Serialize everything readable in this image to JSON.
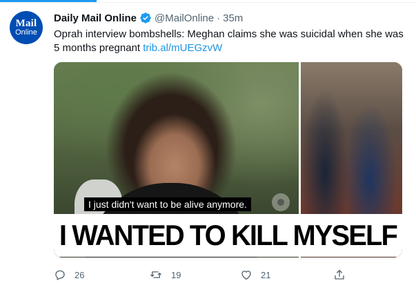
{
  "tweet": {
    "avatar": {
      "line1": "Mail",
      "line2": "Online"
    },
    "author_name": "Daily Mail Online",
    "handle": "@MailOnline",
    "separator": "·",
    "time": "35m",
    "text": "Oprah interview bombshells: Meghan claims she was suicidal when she was 5 months pregnant",
    "link": "trib.al/mUEGzvW"
  },
  "media": {
    "caption": "I just didn't want to be alive anymore.",
    "headline": "I WANTED TO KILL MYSELF"
  },
  "actions": {
    "reply_count": "26",
    "retweet_count": "19",
    "like_count": "21"
  },
  "colors": {
    "accent": "#1d9bf0",
    "link": "#1b95e0",
    "muted": "#536471",
    "avatar_bg": "#004db3"
  },
  "icons": [
    "verified-badge-icon",
    "reply-icon",
    "retweet-icon",
    "like-icon",
    "share-icon",
    "cbs-eye-logo"
  ]
}
